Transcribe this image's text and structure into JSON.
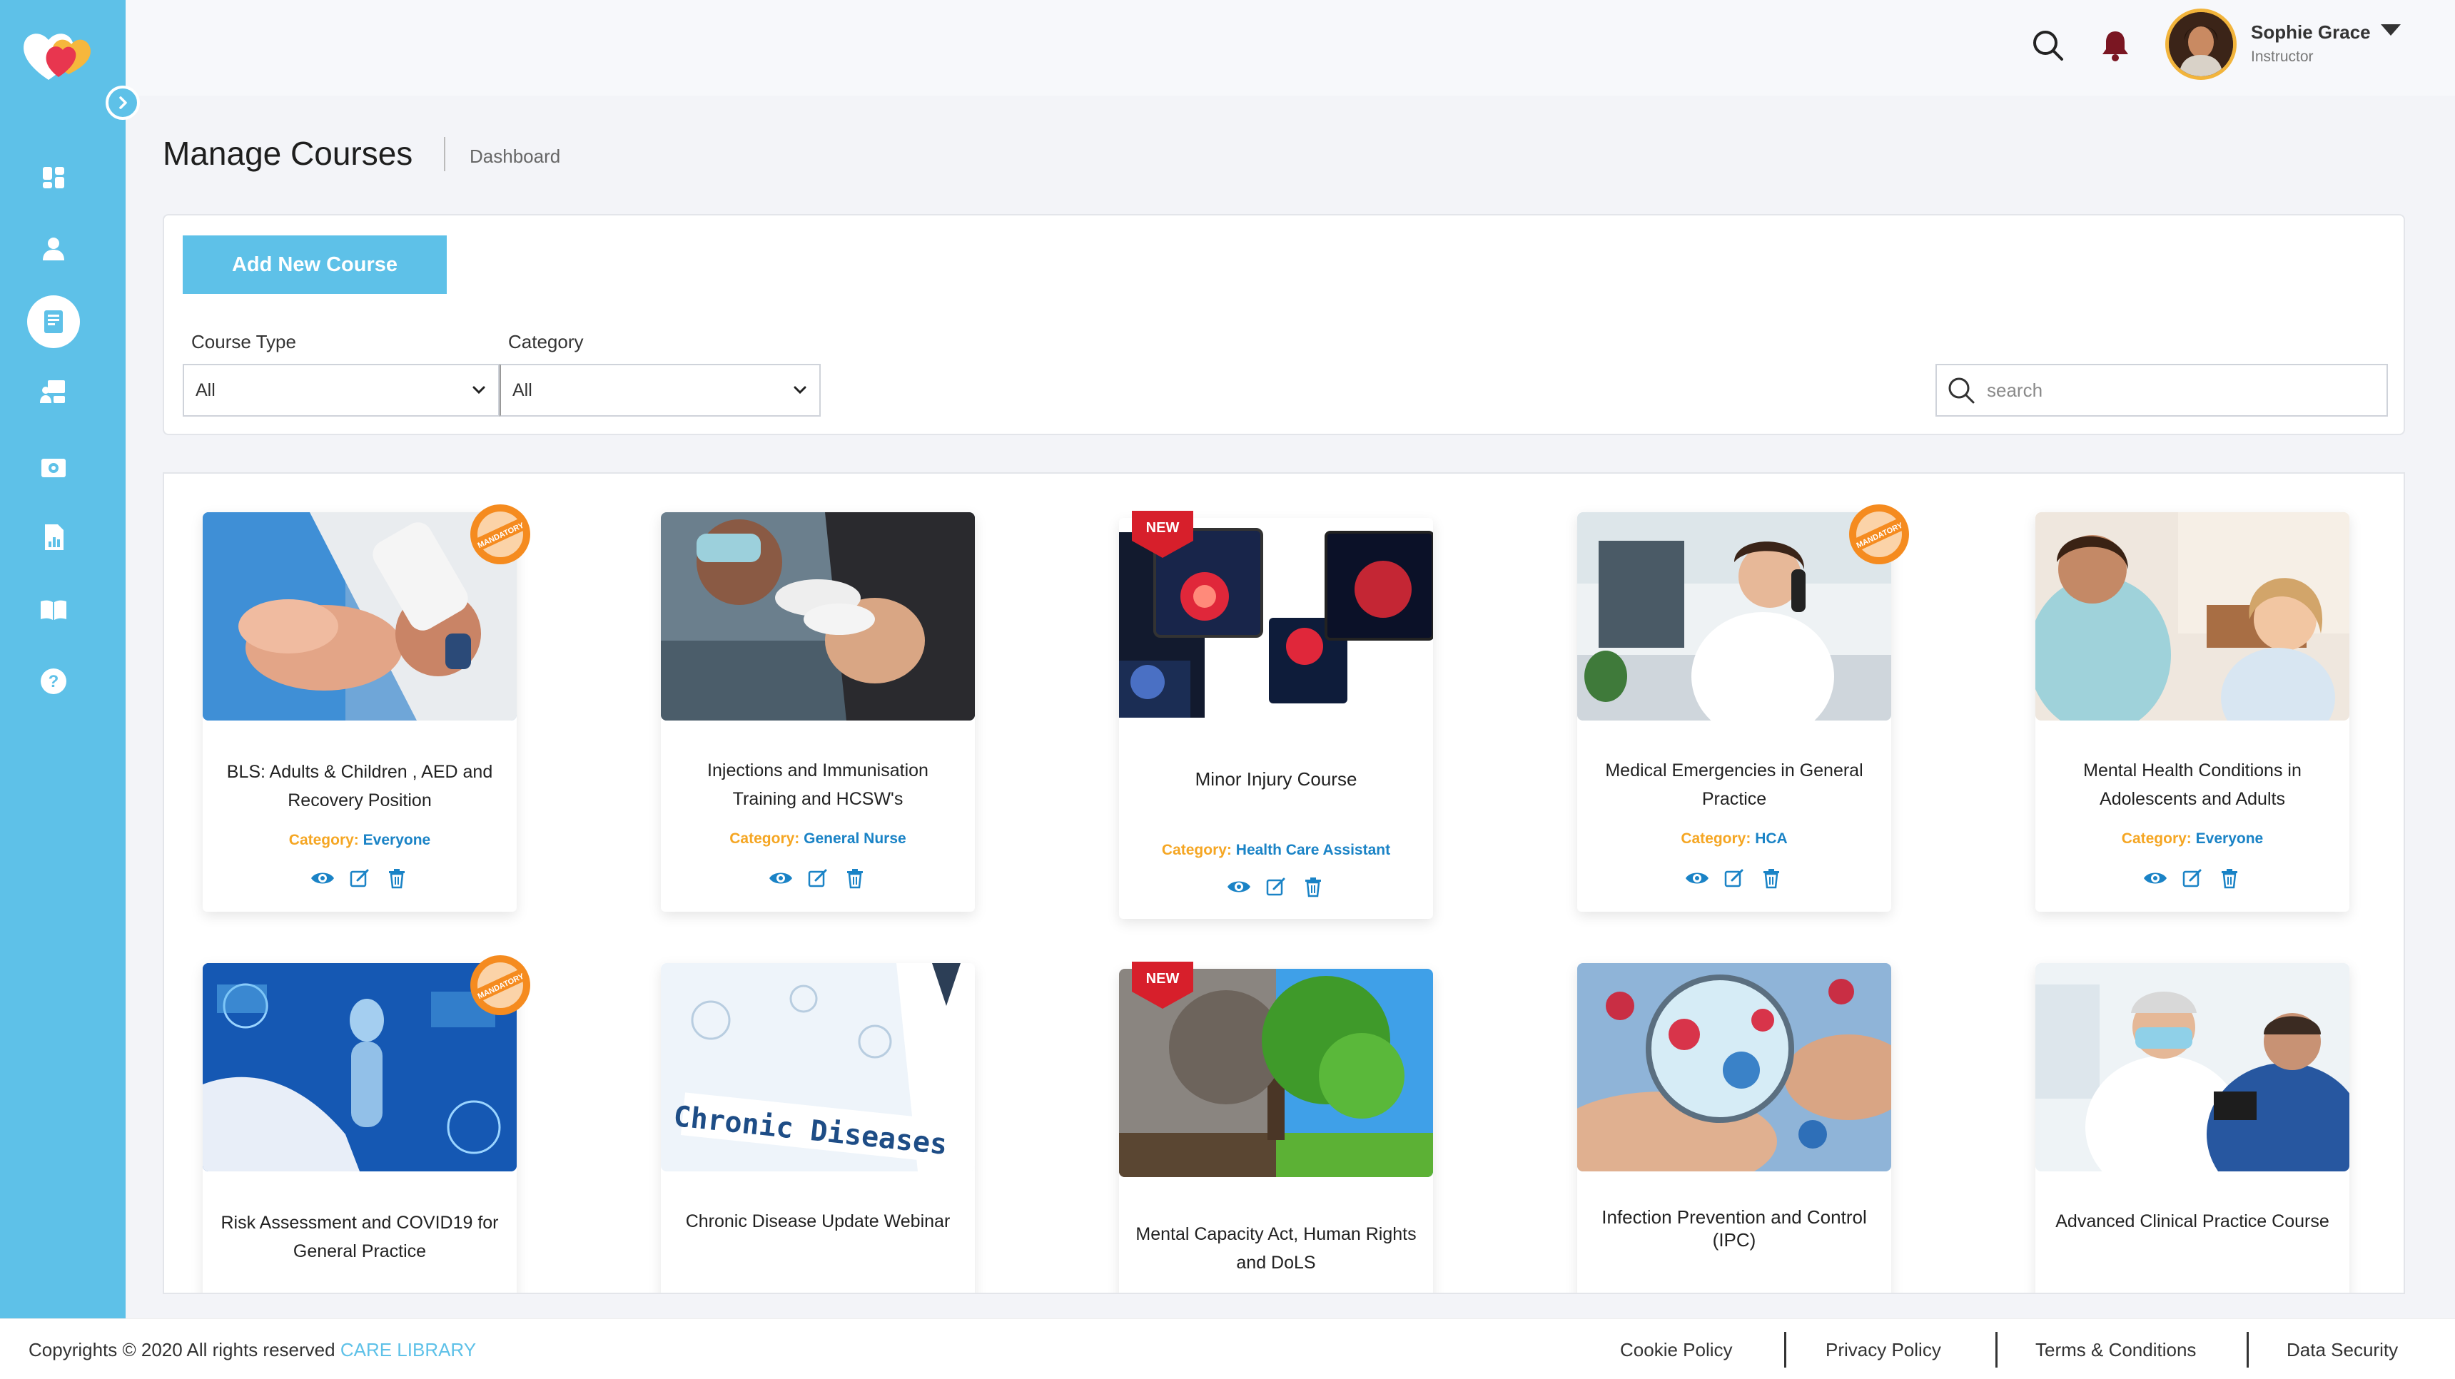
{
  "colors": {
    "accent": "#5ec1e8",
    "category_key": "#f5a623",
    "category_value": "#1a83c6",
    "bell": "#7a1622"
  },
  "header": {
    "user_name": "Sophie Grace",
    "user_role": "Instructor",
    "icons": [
      "search-icon",
      "bell-icon",
      "caret-down-icon"
    ]
  },
  "sidebar": {
    "items": [
      {
        "icon": "dashboard-icon"
      },
      {
        "icon": "user-icon"
      },
      {
        "icon": "course-book-icon",
        "active": true
      },
      {
        "icon": "classroom-icon"
      },
      {
        "icon": "video-icon"
      },
      {
        "icon": "report-icon"
      },
      {
        "icon": "library-icon"
      },
      {
        "icon": "help-icon"
      }
    ]
  },
  "page": {
    "title": "Manage Courses",
    "breadcrumb": "Dashboard"
  },
  "filters": {
    "add_button": "Add New Course",
    "course_type_label": "Course Type",
    "course_type_value": "All",
    "category_label": "Category",
    "category_value": "All",
    "search_placeholder": "search"
  },
  "cards": [
    {
      "title": "BLS: Adults & Children , AED and Recovery Position",
      "category_key": "Category:",
      "category": "Everyone",
      "badge": "mandatory"
    },
    {
      "title": "Injections and Immunisation Training and HCSW's",
      "category_key": "Category:",
      "category": "General Nurse",
      "badge": ""
    },
    {
      "title": "Minor Injury Course",
      "category_key": "Category:",
      "category": "Health Care Assistant",
      "badge": "new"
    },
    {
      "title": "Medical Emergencies in General Practice",
      "category_key": "Category:",
      "category": "HCA",
      "badge": "mandatory"
    },
    {
      "title": "Mental Health Conditions in Adolescents and Adults",
      "category_key": "Category:",
      "category": "Everyone",
      "badge": ""
    },
    {
      "title": "Risk Assessment and COVID19 for General Practice",
      "badge": "mandatory"
    },
    {
      "title": "Chronic Disease Update Webinar",
      "image_text": "Chronic Diseases",
      "badge": ""
    },
    {
      "title": "Mental Capacity Act, Human Rights and DoLS",
      "badge": "new"
    },
    {
      "title": "Infection Prevention and Control (IPC)",
      "badge": ""
    },
    {
      "title": "Advanced Clinical Practice Course",
      "badge": ""
    }
  ],
  "badges": {
    "new": "NEW",
    "mandatory": "MANDATORY"
  },
  "footer": {
    "copyright": "Copyrights © 2020  All rights reserved",
    "brand": "CARE LIBRARY",
    "links": [
      "Cookie Policy",
      "Privacy Policy",
      "Terms & Conditions",
      "Data Security"
    ]
  }
}
